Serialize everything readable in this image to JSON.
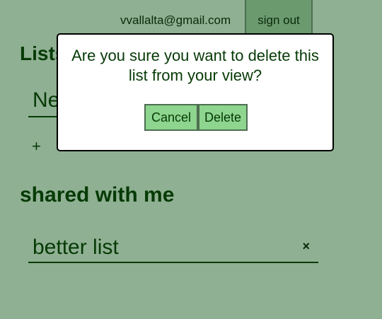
{
  "header": {
    "user_email": "vvallalta@gmail.com",
    "sign_out_label": "sign out"
  },
  "lists": {
    "heading": "Lists",
    "new_list_placeholder": "New list",
    "add_symbol": "+"
  },
  "shared": {
    "heading": "shared with me",
    "items": [
      {
        "name": "better list",
        "remove_symbol": "×"
      }
    ]
  },
  "dialog": {
    "message": "Are you sure you want to delete this list from your view?",
    "cancel_label": "Cancel",
    "delete_label": "Delete"
  },
  "colors": {
    "background": "#8fb092",
    "text": "#063a06",
    "button_fill": "#8ed58f",
    "sign_out_fill": "#6b9a6f"
  }
}
